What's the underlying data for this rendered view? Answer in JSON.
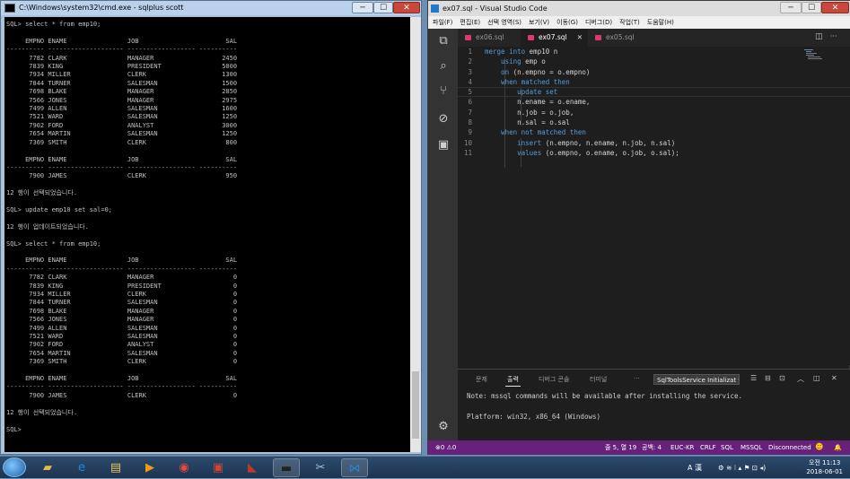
{
  "cmd": {
    "title": "C:\\Windows\\system32\\cmd.exe - sqlplus  scott",
    "min": "─",
    "max": "☐",
    "close": "✕",
    "lines": [
      "SQL> select * from emp10;",
      "",
      "     EMPNO ENAME                JOB                       SAL",
      "---------- -------------------- ------------------ ----------",
      "      7782 CLARK                MANAGER                  2450",
      "      7839 KING                 PRESIDENT                5000",
      "      7934 MILLER               CLERK                    1300",
      "      7844 TURNER               SALESMAN                 1500",
      "      7698 BLAKE                MANAGER                  2850",
      "      7566 JONES                MANAGER                  2975",
      "      7499 ALLEN                SALESMAN                 1600",
      "      7521 WARD                 SALESMAN                 1250",
      "      7902 FORD                 ANALYST                  3000",
      "      7654 MARTIN               SALESMAN                 1250",
      "      7369 SMITH                CLERK                     800",
      "",
      "     EMPNO ENAME                JOB                       SAL",
      "---------- -------------------- ------------------ ----------",
      "      7900 JAMES                CLERK                     950",
      "",
      "12 행이 선택되었습니다.",
      "",
      "SQL> update emp10 set sal=0;",
      "",
      "12 행이 업데이트되었습니다.",
      "",
      "SQL> select * from emp10;",
      "",
      "     EMPNO ENAME                JOB                       SAL",
      "---------- -------------------- ------------------ ----------",
      "      7782 CLARK                MANAGER                     0",
      "      7839 KING                 PRESIDENT                   0",
      "      7934 MILLER               CLERK                       0",
      "      7844 TURNER               SALESMAN                    0",
      "      7698 BLAKE                MANAGER                     0",
      "      7566 JONES                MANAGER                     0",
      "      7499 ALLEN                SALESMAN                    0",
      "      7521 WARD                 SALESMAN                    0",
      "      7902 FORD                 ANALYST                     0",
      "      7654 MARTIN               SALESMAN                    0",
      "      7369 SMITH                CLERK                       0",
      "",
      "     EMPNO ENAME                JOB                       SAL",
      "---------- -------------------- ------------------ ----------",
      "      7900 JAMES                CLERK                       0",
      "",
      "12 행이 선택되었습니다.",
      "",
      "SQL>"
    ]
  },
  "vscode": {
    "title": "ex07.sql - Visual Studio Code",
    "min": "─",
    "max": "☐",
    "close": "✕",
    "menu": [
      "파일(F)",
      "편집(E)",
      "선택 영역(S)",
      "보기(V)",
      "이동(G)",
      "디버그(D)",
      "작업(T)",
      "도움말(H)"
    ],
    "tabs": [
      {
        "label": "ex06.sql"
      },
      {
        "label": "ex07.sql",
        "close": "✕"
      },
      {
        "label": "ex05.sql"
      }
    ],
    "editor_actions": [
      "◫",
      "···"
    ],
    "code": [
      {
        "n": "1",
        "a": "merge into",
        "b": " emp10 n"
      },
      {
        "n": "2",
        "a": "    using",
        "b": " emp o"
      },
      {
        "n": "3",
        "a": "    on",
        "b": " (n.empno = o.empno)"
      },
      {
        "n": "4",
        "a": "    when matched then",
        "b": ""
      },
      {
        "n": "5",
        "a": "        update set",
        "b": ""
      },
      {
        "n": "6",
        "a": "",
        "b": "        n.ename = o.ename,"
      },
      {
        "n": "7",
        "a": "",
        "b": "        n.job = o.job,"
      },
      {
        "n": "8",
        "a": "",
        "b": "        n.sal = o.sal"
      },
      {
        "n": "9",
        "a": "    when not matched then",
        "b": ""
      },
      {
        "n": "10",
        "a": "        insert",
        "b": " (n.empno, n.ename, n.job, n.sal)"
      },
      {
        "n": "11",
        "a": "        values",
        "b": " (o.empno, o.ename, o.job, o.sal);"
      }
    ],
    "panel": {
      "tabs": [
        "문제",
        "출력",
        "디버그 콘솔",
        "터미널"
      ],
      "more": "···",
      "dropdown": "SqlToolsService Initializat ▾",
      "icons": [
        "☰",
        "⊟",
        "⊡",
        "︿",
        "◫",
        "✕"
      ],
      "output": [
        "Note: mssql commands will be available after installing the service.",
        "",
        "Platform: win32, x86_64 (Windows)"
      ]
    },
    "activity_icons": [
      "⧉",
      "⌕",
      "⑂",
      "⊘",
      "▣",
      "⚙"
    ],
    "status": {
      "problems": "⊗0 ⚠0",
      "position": "줄 5, 열 19",
      "spaces": "공백: 4",
      "encoding": "EUC-KR",
      "eol": "CRLF",
      "language": "SQL",
      "server": "MSSQL",
      "connection": "Disconnected",
      "smiley": "☻",
      "bell": "🔔"
    }
  },
  "taskbar": {
    "apps": [
      {
        "icon": "▰"
      },
      {
        "icon": "e"
      },
      {
        "icon": "▤"
      },
      {
        "icon": "▶"
      },
      {
        "icon": "◉"
      },
      {
        "icon": "▣"
      },
      {
        "icon": "◣"
      },
      {
        "icon": "▬"
      },
      {
        "icon": "✂"
      },
      {
        "icon": "⋈"
      }
    ],
    "ime": "A 漢",
    "tray": "⚙ ≋ ⁝ ▴ ⚑ ⊡ ◂)",
    "time": "오전 11:13",
    "date": "2018-06-01"
  }
}
